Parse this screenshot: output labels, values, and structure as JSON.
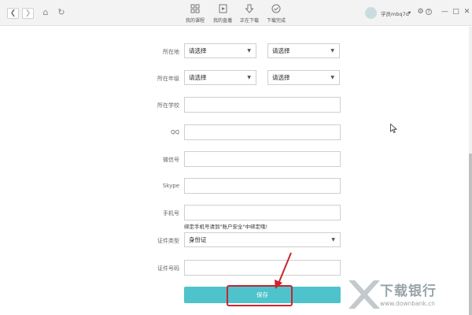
{
  "toolbar": {
    "tabs": [
      {
        "label": "我的课程",
        "icon": "grid-icon"
      },
      {
        "label": "我的直播",
        "icon": "live-icon"
      },
      {
        "label": "正在下载",
        "icon": "download-icon"
      },
      {
        "label": "下载完成",
        "icon": "check-circle-icon"
      }
    ],
    "username": "学员mbq7d",
    "dropdown": "▾"
  },
  "form": {
    "location": {
      "label": "所在地",
      "select1": "请选择",
      "select2": "请选择"
    },
    "grade": {
      "label": "所在年级",
      "select1": "请选择",
      "select2": "请选择"
    },
    "school": {
      "label": "所在学校",
      "value": ""
    },
    "qq": {
      "label": "QQ",
      "value": ""
    },
    "wechat": {
      "label": "微信号",
      "value": ""
    },
    "skype": {
      "label": "Skype",
      "value": ""
    },
    "phone": {
      "label": "手机号",
      "value": "",
      "hint": "绑定手机号请到\"账户安全\"中绑定哦!"
    },
    "id_type": {
      "label": "证件类型",
      "value": "身份证"
    },
    "id_number": {
      "label": "证件号码",
      "value": ""
    },
    "save_label": "保存"
  },
  "colors": {
    "accent": "#4ec3cb",
    "highlight": "#c8262c"
  },
  "watermark": {
    "name": "下载银行",
    "url": "www.downbank.cn"
  }
}
